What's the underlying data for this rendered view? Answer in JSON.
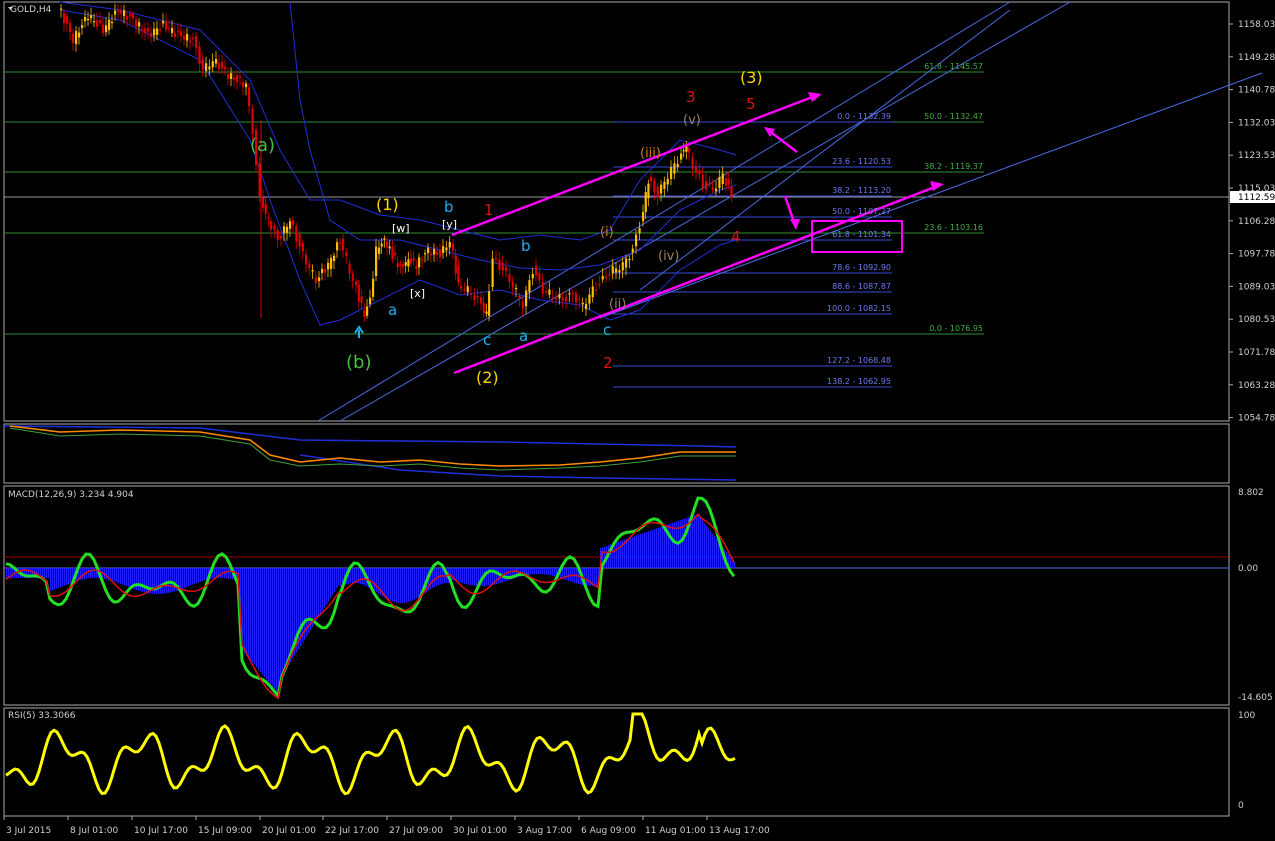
{
  "window": {
    "symbol_title": "GOLD,H4"
  },
  "colors": {
    "background": "#000000",
    "bull_candle": "#ffbf00",
    "bear_candle": "#e00000",
    "bollinger": "#1f2fd8",
    "fib": "#4a5ad8",
    "fib_green": "#2f9f2f",
    "channel": "#ff00ff",
    "macd_hist": "#2020ff",
    "macd_line": "#22e022",
    "rsi_line": "#ffff00"
  },
  "price_axis": {
    "ticks": [
      "1158.03",
      "1149.28",
      "1140.78",
      "1132.03",
      "1123.53",
      "1115.03",
      "1106.28",
      "1097.78",
      "1089.03",
      "1080.53",
      "1071.78",
      "1063.28",
      "1054.78"
    ],
    "current_price": "1112.59"
  },
  "time_axis": {
    "ticks": [
      "3 Jul 2015",
      "8 Jul 01:00",
      "10 Jul 17:00",
      "15 Jul 09:00",
      "20 Jul 01:00",
      "22 Jul 17:00",
      "27 Jul 09:00",
      "30 Jul 01:00",
      "3 Aug 17:00",
      "6 Aug 09:00",
      "11 Aug 01:00",
      "13 Aug 17:00"
    ]
  },
  "fib_levels_blue": [
    "0.0 - 1132.39",
    "23.6 - 1120.53",
    "38.2 - 1113.20",
    "50.0 - 1107.27",
    "61.8 - 1101.34",
    "78.6 - 1092.90",
    "88.6 - 1087.87",
    "100.0 - 1082.15",
    "127.2 - 1068.48",
    "138.2 - 1062.95"
  ],
  "fib_levels_green": [
    "61.8 - 1145.57",
    "50.0 - 1132.47",
    "38.2 - 1119.37",
    "23.6 - 1103.16",
    "0.0 - 1076.95"
  ],
  "wave_labels": {
    "a_green": "(a)",
    "b_green": "(b)",
    "w1_yellow": "(1)",
    "w2_yellow": "(2)",
    "w3_yellow": "(3)",
    "sub_w": "[w]",
    "sub_x": "[x]",
    "sub_y": "[y]",
    "cyan_b1": "b",
    "cyan_a1": "a",
    "cyan_c1": "c",
    "cyan_b2": "b",
    "cyan_a2": "a",
    "cyan_c2": "c",
    "red_1": "1",
    "red_2": "2",
    "red_3": "3",
    "red_4": "4",
    "red_5": "5",
    "orange_i": "(i)",
    "orange_ii": "(ii)",
    "orange_iii": "(iii)",
    "orange_iv": "(iv)",
    "orange_v": "(v)"
  },
  "macd": {
    "label": "MACD(12,26,9) 3.234 4.904",
    "max": "8.802",
    "zero": "0.00",
    "min": "-14.605"
  },
  "rsi": {
    "label": "RSI(5) 33.3066",
    "max": "100",
    "min": "0"
  },
  "chart_data": {
    "type": "line",
    "title": "GOLD,H4",
    "xlabel": "",
    "ylabel": "",
    "ylim": [
      1054.78,
      1162
    ],
    "x": [
      "3 Jul 2015",
      "8 Jul 01:00",
      "10 Jul 17:00",
      "15 Jul 09:00",
      "20 Jul 01:00",
      "22 Jul 17:00",
      "27 Jul 09:00",
      "30 Jul 01:00",
      "3 Aug 17:00",
      "6 Aug 09:00",
      "11 Aug 01:00",
      "13 Aug 17:00"
    ],
    "series": [
      {
        "values": [
          1163,
          1160,
          1158,
          1150,
          1110,
          1092,
          1098,
          1090,
          1087,
          1092,
          1122,
          1114
        ]
      }
    ],
    "grid": false
  }
}
